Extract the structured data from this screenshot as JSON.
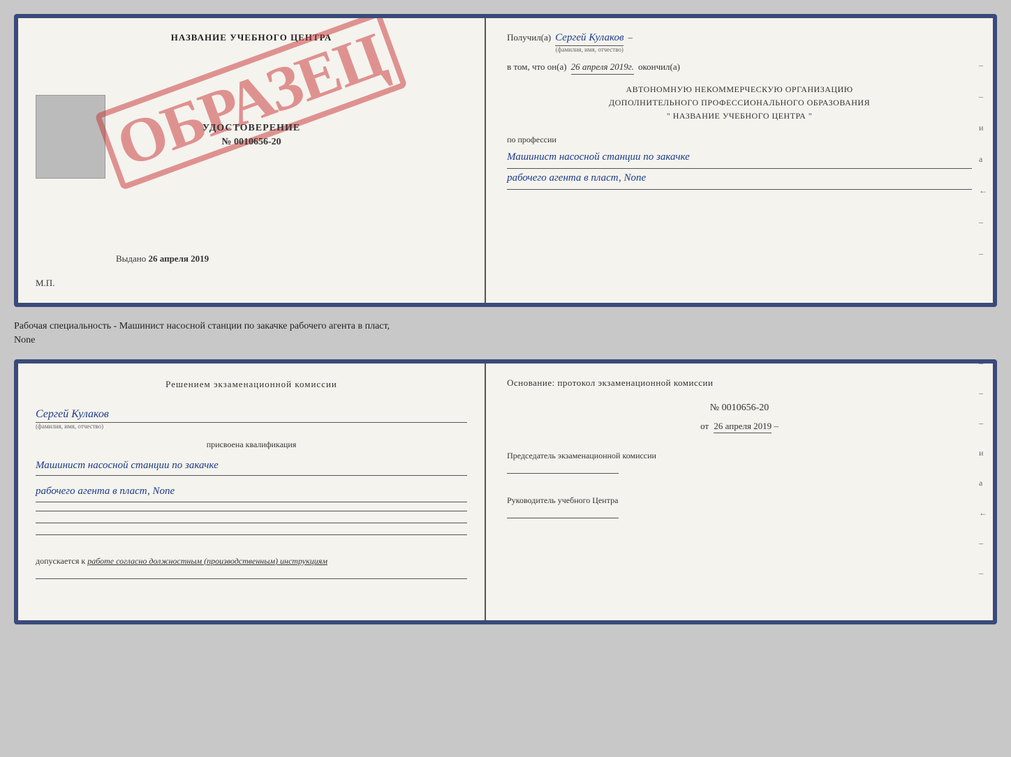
{
  "top_doc": {
    "left": {
      "institution_name": "НАЗВАНИЕ УЧЕБНОГО ЦЕНТРА",
      "obrazec_text": "ОБРАЗЕЦ",
      "udostoverenie_title": "УДОСТОВЕРЕНИЕ",
      "udostoverenie_num": "№ 0010656-20",
      "vydano_label": "Выдано",
      "vydano_date": "26 апреля 2019",
      "mp": "М.П."
    },
    "right": {
      "poluchil_label": "Получил(а)",
      "recipient_name": "Сергей Кулаков",
      "family_label": "(фамилия, имя, отчество)",
      "vtom_label": "в том, что он(а)",
      "date_value": "26 апреля 2019г.",
      "okonchil_label": "окончил(а)",
      "org_line1": "АВТОНОМНУЮ НЕКОММЕРЧЕСКУЮ ОРГАНИЗАЦИЮ",
      "org_line2": "ДОПОЛНИТЕЛЬНОГО ПРОФЕССИОНАЛЬНОГО ОБРАЗОВАНИЯ",
      "org_line3": "\" НАЗВАНИЕ УЧЕБНОГО ЦЕНТРА \"",
      "po_professii": "по профессии",
      "profession_line1": "Машинист насосной станции по закачке",
      "profession_line2": "рабочего агента в пласт, None"
    }
  },
  "subtitle": {
    "text": "Рабочая специальность - Машинист насосной станции по закачке рабочего агента в пласт,",
    "text2": "None"
  },
  "bottom_doc": {
    "left": {
      "commission_title": "Решением экзаменационной комиссии",
      "person_name": "Сергей Кулаков",
      "family_sublabel": "(фамилия, имя, отчество)",
      "prisvoena_label": "присвоена квалификация",
      "qual_line1": "Машинист насосной станции по закачке",
      "qual_line2": "рабочего агента в пласт, None",
      "dopuskaetsya_label": "допускается к",
      "dopuskaetsya_value": "работе согласно должностным (производственным) инструкциям"
    },
    "right": {
      "osnov_label": "Основание: протокол экзаменационной комиссии",
      "protocol_num": "№ 0010656-20",
      "ot_label": "от",
      "date_value": "26 апреля 2019",
      "chairman_label": "Председатель экзаменационной комиссии",
      "rukov_label": "Руководитель учебного Центра"
    }
  },
  "dashes": [
    "-",
    "-",
    "и",
    "а",
    "←",
    "-",
    "-"
  ]
}
